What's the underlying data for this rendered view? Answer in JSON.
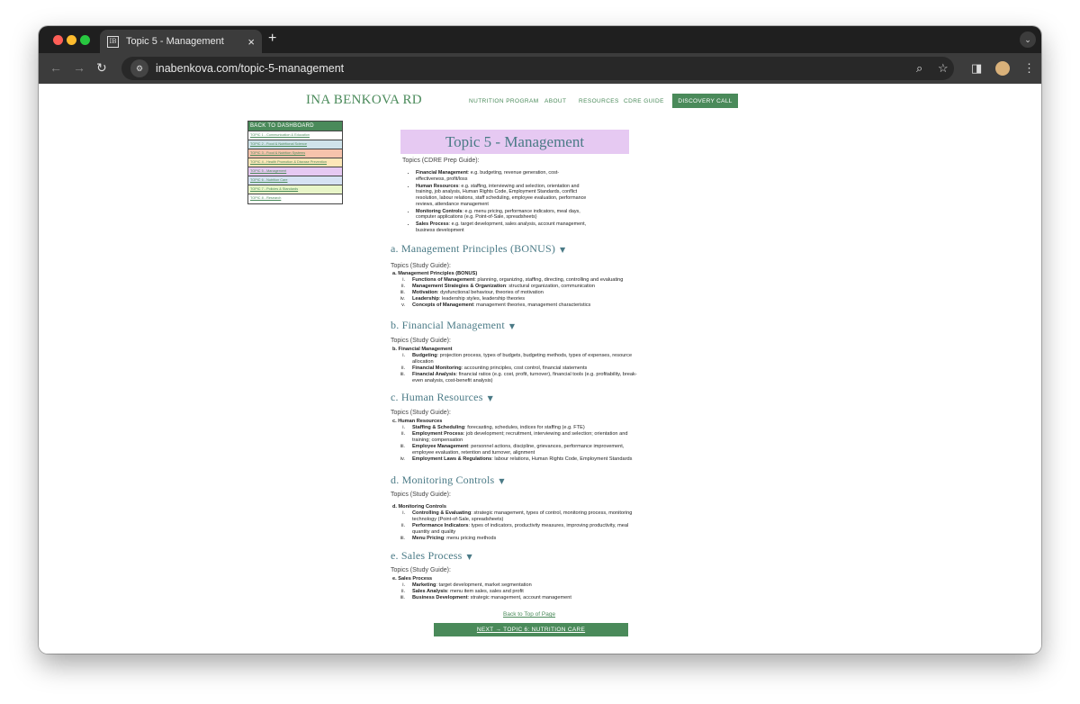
{
  "browser": {
    "tab_title": "Topic 5 - Management",
    "tab_favicon": "IB",
    "url": "inabenkova.com/topic-5-management"
  },
  "header": {
    "brand": "INA BENKOVA RD",
    "menu": [
      "NUTRITION PROGRAM",
      "ABOUT",
      "RESOURCES",
      "CDRE GUIDE"
    ],
    "cta": "DISCOVERY CALL"
  },
  "sidebar": {
    "heading": "BACK TO DASHBOARD",
    "items": [
      {
        "label": "TOPIC 1 - Communication & Education",
        "color": "#ffffff"
      },
      {
        "label": "TOPIC 2 - Food & Nutritional Science",
        "color": "#cfe3ea"
      },
      {
        "label": "TOPIC 3 - Food & Nutrition Systems",
        "color": "#f6c3ac"
      },
      {
        "label": "TOPIC 4 - Health Promotion & Disease Prevention",
        "color": "#fde7b8"
      },
      {
        "label": "TOPIC 5 - Management",
        "color": "#e6c9f2"
      },
      {
        "label": "TOPIC 6 - Nutrition Care",
        "color": "#d6e2f3"
      },
      {
        "label": "TOPIC 7 - Policies & Standards",
        "color": "#e8f5c8"
      },
      {
        "label": "TOPIC 8 - Research",
        "color": "#ffffff"
      }
    ]
  },
  "page": {
    "title": "Topic 5 - Management",
    "cdre_caption": "Topics (CDRE Prep Guide):",
    "cdre_items": [
      {
        "b": "Financial Management",
        "t": ": e.g. budgeting, revenue generation, cost-effectiveness, profit/loss"
      },
      {
        "b": "Human Resources",
        "t": ": e.g. staffing, interviewing and selection, orientation and training, job analysis, Human Rights Code, Employment Standards, conflict resolution, labour relations, staff scheduling, employee evaluation, performance reviews, attendance management"
      },
      {
        "b": "Monitoring Controls",
        "t": ": e.g. menu pricing, performance indicators, meal days, computer applications (e.g. Point-of-Sale, spreadsheets)"
      },
      {
        "b": "Sales Process",
        "t": ": e.g. target development, sales analysis, account management, business development"
      }
    ],
    "study_caption": "Topics (Study Guide):",
    "sections": [
      {
        "heading": "a. Management Principles (BONUS)",
        "sub": "a.  Management Principles (BONUS)",
        "items": [
          {
            "n": "i.",
            "b": "Functions of Management",
            "t": ": planning, organizing, staffing, directing, controlling and evaluating"
          },
          {
            "n": "ii.",
            "b": "Management Strategies & Organization",
            "t": ": structural organization, communication"
          },
          {
            "n": "iii.",
            "b": "Motivation",
            "t": ": dysfunctional behaviour, theories of motivation"
          },
          {
            "n": "iv.",
            "b": "Leadership",
            "t": ": leadership styles, leadership theories"
          },
          {
            "n": "v.",
            "b": "Concepts of Management",
            "t": ": management theories, management characteristics"
          }
        ]
      },
      {
        "heading": "b. Financial Management",
        "sub": "b.  Financial Management",
        "items": [
          {
            "n": "i.",
            "b": "Budgeting",
            "t": ": projection process, types of budgets, budgeting methods, types of expenses, resource allocation"
          },
          {
            "n": "ii.",
            "b": "Financial Monitoring",
            "t": ": accounting principles, cost control, financial statements"
          },
          {
            "n": "iii.",
            "b": "Financial Analysis",
            "t": ": financial ratios (e.g. cost, profit, turnover), financial tools (e.g. profitability, break-even analysis, cost-benefit analysis)"
          }
        ]
      },
      {
        "heading": "c. Human Resources",
        "sub": "c.  Human Resources",
        "items": [
          {
            "n": "i.",
            "b": "Staffing & Scheduling",
            "t": ": forecasting, schedules, indices for staffing (e.g. FTE)"
          },
          {
            "n": "ii.",
            "b": "Employment Process",
            "t": ": job development; recruitment, interviewing and selection; orientation and training; compensation"
          },
          {
            "n": "iii.",
            "b": "Employee Management",
            "t": ": personnel actions, discipline, grievances, performance improvement, employee evaluation, retention and turnover, alignment"
          },
          {
            "n": "iv.",
            "b": "Employment Laws & Regulations",
            "t": ": labour relations, Human Rights Code, Employment Standards"
          }
        ]
      },
      {
        "heading": "d. Monitoring Controls",
        "sub": "d.  Monitoring Controls",
        "items": [
          {
            "n": "i.",
            "b": "Controlling & Evaluating",
            "t": ": strategic management, types of control, monitoring process, monitoring technology (Point-of-Sale, spreadsheets)"
          },
          {
            "n": "ii.",
            "b": "Performance Indicators",
            "t": ": types of indicators, productivity measures, improving productivity, meal quantity and quality"
          },
          {
            "n": "iii.",
            "b": "Menu Pricing",
            "t": ": menu pricing methods"
          }
        ]
      },
      {
        "heading": "e. Sales Process",
        "sub": "e.  Sales Process",
        "items": [
          {
            "n": "i.",
            "b": "Marketing",
            "t": ": target development, market segmentation"
          },
          {
            "n": "ii.",
            "b": "Sales Analysis",
            "t": ": menu item sales, sales and profit"
          },
          {
            "n": "iii.",
            "b": "Business Development",
            "t": ": strategic management, account management"
          }
        ]
      }
    ],
    "back_to_top": "Back to Top of Page",
    "next_button": "NEXT → TOPIC 6: NUTRITION CARE"
  },
  "colors": {
    "brand_green": "#4a8a5a",
    "heading_teal": "#4a7a86",
    "title_bg": "#e6c9f2"
  }
}
